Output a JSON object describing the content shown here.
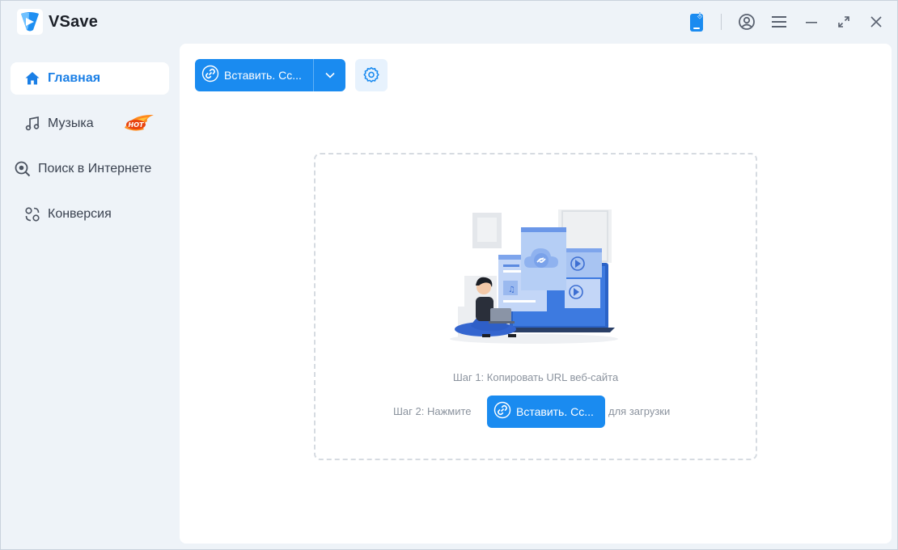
{
  "app": {
    "title": "VSave",
    "accent": "#1a8bf0"
  },
  "titlebar": {
    "icons": [
      "phone-download-icon",
      "account-icon",
      "menu-icon",
      "minimize-icon",
      "maximize-icon",
      "close-icon"
    ]
  },
  "sidebar": {
    "items": [
      {
        "label": "Главная",
        "icon": "home-icon",
        "active": true
      },
      {
        "label": "Музыка",
        "icon": "music-note-icon",
        "badge": "HOT"
      },
      {
        "label": "Поиск в Интернете",
        "icon": "web-search-icon"
      },
      {
        "label": "Конверсия",
        "icon": "conversion-icon"
      }
    ]
  },
  "toolbar": {
    "paste_label": "Вставить. Сс...",
    "dropdown_icon": "chevron-down-icon",
    "settings_icon": "gear-icon"
  },
  "dropzone": {
    "step1": "Шаг 1: Копировать URL веб-сайта",
    "step2_before": "Шаг 2: Нажмите",
    "step2_button": "Вставить. Сс...",
    "step2_after": "для загрузки"
  }
}
